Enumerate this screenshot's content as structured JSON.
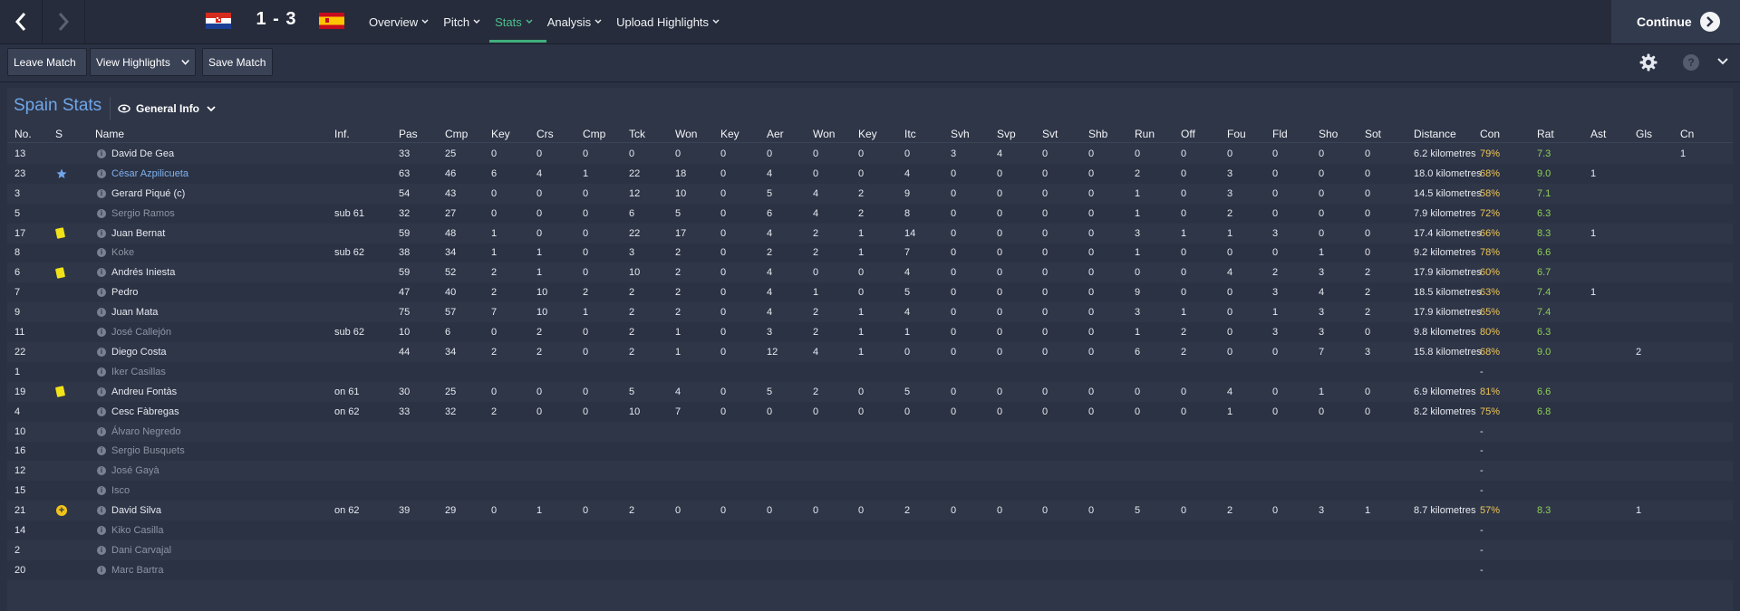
{
  "header": {
    "score": "1 - 3",
    "home_flag": "croatia-flag",
    "away_flag": "spain-flag",
    "menu": [
      {
        "label": "Overview",
        "active": false
      },
      {
        "label": "Pitch",
        "active": false
      },
      {
        "label": "Stats",
        "active": true
      },
      {
        "label": "Analysis",
        "active": false
      },
      {
        "label": "Upload Highlights",
        "active": false
      }
    ],
    "continue_label": "Continue"
  },
  "toolbar": {
    "leave_label": "Leave Match",
    "highlights_label": "View Highlights",
    "save_label": "Save Match"
  },
  "panel": {
    "title": "Spain Stats",
    "view_label": "General Info"
  },
  "colors": {
    "accent_green": "#3fae7c",
    "title_blue": "#6fa6e8",
    "condition_yellow": "#f0c654",
    "rating_green": "#8fcf5a",
    "yellow_card": "#f2e318"
  },
  "table": {
    "columns": [
      "No.",
      "S",
      "Name",
      "Inf.",
      "Pas",
      "Cmp",
      "Key",
      "Crs",
      "Cmp",
      "Tck",
      "Won",
      "Key",
      "Aer",
      "Won",
      "Key",
      "Itc",
      "Svh",
      "Svp",
      "Svt",
      "Shb",
      "Run",
      "Off",
      "Fou",
      "Fld",
      "Sho",
      "Sot",
      "Distance",
      "Con",
      "Rat",
      "Ast",
      "Gls",
      "Cn"
    ],
    "rows": [
      {
        "no": "13",
        "s": "",
        "name": "David De Gea",
        "style": "normal",
        "inf": "",
        "stats": [
          "33",
          "25",
          "0",
          "0",
          "0",
          "0",
          "0",
          "0",
          "0",
          "0",
          "0",
          "0",
          "3",
          "4",
          "0",
          "0",
          "0",
          "0",
          "0",
          "0",
          "0",
          "0"
        ],
        "dist": "6.2 kilometres",
        "con": "79%",
        "rat": "7.3",
        "ast": "",
        "gls": "",
        "cn": "1"
      },
      {
        "no": "23",
        "s": "star",
        "name": "César Azpilicueta",
        "style": "link",
        "inf": "",
        "stats": [
          "63",
          "46",
          "6",
          "4",
          "1",
          "22",
          "18",
          "0",
          "4",
          "0",
          "0",
          "4",
          "0",
          "0",
          "0",
          "0",
          "2",
          "0",
          "3",
          "0",
          "0",
          "0"
        ],
        "dist": "18.0 kilometres",
        "con": "68%",
        "rat": "9.0",
        "ast": "1",
        "gls": "",
        "cn": ""
      },
      {
        "no": "3",
        "s": "",
        "name": "Gerard Piqué (c)",
        "style": "normal",
        "inf": "",
        "stats": [
          "54",
          "43",
          "0",
          "0",
          "0",
          "12",
          "10",
          "0",
          "5",
          "4",
          "2",
          "9",
          "0",
          "0",
          "0",
          "0",
          "1",
          "0",
          "3",
          "0",
          "0",
          "0"
        ],
        "dist": "14.5 kilometres",
        "con": "58%",
        "rat": "7.1",
        "ast": "",
        "gls": "",
        "cn": ""
      },
      {
        "no": "5",
        "s": "",
        "name": "Sergio Ramos",
        "style": "dim",
        "inf": "sub 61",
        "stats": [
          "32",
          "27",
          "0",
          "0",
          "0",
          "6",
          "5",
          "0",
          "6",
          "4",
          "2",
          "8",
          "0",
          "0",
          "0",
          "0",
          "1",
          "0",
          "2",
          "0",
          "0",
          "0"
        ],
        "dist": "7.9 kilometres",
        "con": "72%",
        "rat": "6.3",
        "ast": "",
        "gls": "",
        "cn": ""
      },
      {
        "no": "17",
        "s": "yellow",
        "name": "Juan Bernat",
        "style": "normal",
        "inf": "",
        "stats": [
          "59",
          "48",
          "1",
          "0",
          "0",
          "22",
          "17",
          "0",
          "4",
          "2",
          "1",
          "14",
          "0",
          "0",
          "0",
          "0",
          "3",
          "1",
          "1",
          "3",
          "0",
          "0"
        ],
        "dist": "17.4 kilometres",
        "con": "66%",
        "rat": "8.3",
        "ast": "1",
        "gls": "",
        "cn": ""
      },
      {
        "no": "8",
        "s": "",
        "name": "Koke",
        "style": "dim",
        "inf": "sub 62",
        "stats": [
          "38",
          "34",
          "1",
          "1",
          "0",
          "3",
          "2",
          "0",
          "2",
          "2",
          "1",
          "7",
          "0",
          "0",
          "0",
          "0",
          "1",
          "0",
          "0",
          "0",
          "1",
          "0"
        ],
        "dist": "9.2 kilometres",
        "con": "78%",
        "rat": "6.6",
        "ast": "",
        "gls": "",
        "cn": ""
      },
      {
        "no": "6",
        "s": "yellow",
        "name": "Andrés Iniesta",
        "style": "normal",
        "inf": "",
        "stats": [
          "59",
          "52",
          "2",
          "1",
          "0",
          "10",
          "2",
          "0",
          "4",
          "0",
          "0",
          "4",
          "0",
          "0",
          "0",
          "0",
          "0",
          "0",
          "4",
          "2",
          "3",
          "2"
        ],
        "dist": "17.9 kilometres",
        "con": "60%",
        "rat": "6.7",
        "ast": "",
        "gls": "",
        "cn": ""
      },
      {
        "no": "7",
        "s": "",
        "name": "Pedro",
        "style": "normal",
        "inf": "",
        "stats": [
          "47",
          "40",
          "2",
          "10",
          "2",
          "2",
          "2",
          "0",
          "4",
          "1",
          "0",
          "5",
          "0",
          "0",
          "0",
          "0",
          "9",
          "0",
          "0",
          "3",
          "4",
          "2"
        ],
        "dist": "18.5 kilometres",
        "con": "63%",
        "rat": "7.4",
        "ast": "1",
        "gls": "",
        "cn": ""
      },
      {
        "no": "9",
        "s": "",
        "name": "Juan Mata",
        "style": "normal",
        "inf": "",
        "stats": [
          "75",
          "57",
          "7",
          "10",
          "1",
          "2",
          "2",
          "0",
          "4",
          "2",
          "1",
          "4",
          "0",
          "0",
          "0",
          "0",
          "3",
          "1",
          "0",
          "1",
          "3",
          "2"
        ],
        "dist": "17.9 kilometres",
        "con": "65%",
        "rat": "7.4",
        "ast": "",
        "gls": "",
        "cn": ""
      },
      {
        "no": "11",
        "s": "",
        "name": "José Callejón",
        "style": "dim",
        "inf": "sub 62",
        "stats": [
          "10",
          "6",
          "0",
          "2",
          "0",
          "2",
          "1",
          "0",
          "3",
          "2",
          "1",
          "1",
          "0",
          "0",
          "0",
          "0",
          "1",
          "2",
          "0",
          "3",
          "3",
          "0"
        ],
        "dist": "9.8 kilometres",
        "con": "80%",
        "rat": "6.3",
        "ast": "",
        "gls": "",
        "cn": ""
      },
      {
        "no": "22",
        "s": "",
        "name": "Diego Costa",
        "style": "normal",
        "inf": "",
        "stats": [
          "44",
          "34",
          "2",
          "2",
          "0",
          "2",
          "1",
          "0",
          "12",
          "4",
          "1",
          "0",
          "0",
          "0",
          "0",
          "0",
          "6",
          "2",
          "0",
          "0",
          "7",
          "3"
        ],
        "dist": "15.8 kilometres",
        "con": "68%",
        "rat": "9.0",
        "ast": "",
        "gls": "2",
        "cn": ""
      },
      {
        "no": "1",
        "s": "",
        "name": "Iker Casillas",
        "style": "dim",
        "inf": "",
        "stats": [],
        "dist": "",
        "con": "-",
        "rat": "",
        "ast": "",
        "gls": "",
        "cn": ""
      },
      {
        "no": "19",
        "s": "yellow",
        "name": "Andreu Fontàs",
        "style": "normal",
        "inf": "on 61",
        "stats": [
          "30",
          "25",
          "0",
          "0",
          "0",
          "5",
          "4",
          "0",
          "5",
          "2",
          "0",
          "5",
          "0",
          "0",
          "0",
          "0",
          "0",
          "0",
          "4",
          "0",
          "1",
          "0"
        ],
        "dist": "6.9 kilometres",
        "con": "81%",
        "rat": "6.6",
        "ast": "",
        "gls": "",
        "cn": ""
      },
      {
        "no": "4",
        "s": "",
        "name": "Cesc Fàbregas",
        "style": "normal",
        "inf": "on 62",
        "stats": [
          "33",
          "32",
          "2",
          "0",
          "0",
          "10",
          "7",
          "0",
          "0",
          "0",
          "0",
          "0",
          "0",
          "0",
          "0",
          "0",
          "0",
          "0",
          "1",
          "0",
          "0",
          "0"
        ],
        "dist": "8.2 kilometres",
        "con": "75%",
        "rat": "6.8",
        "ast": "",
        "gls": "",
        "cn": ""
      },
      {
        "no": "10",
        "s": "",
        "name": "Álvaro Negredo",
        "style": "dim",
        "inf": "",
        "stats": [],
        "dist": "",
        "con": "-",
        "rat": "",
        "ast": "",
        "gls": "",
        "cn": ""
      },
      {
        "no": "16",
        "s": "",
        "name": "Sergio Busquets",
        "style": "dim",
        "inf": "",
        "stats": [],
        "dist": "",
        "con": "-",
        "rat": "",
        "ast": "",
        "gls": "",
        "cn": ""
      },
      {
        "no": "12",
        "s": "",
        "name": "José Gayà",
        "style": "dim",
        "inf": "",
        "stats": [],
        "dist": "",
        "con": "-",
        "rat": "",
        "ast": "",
        "gls": "",
        "cn": ""
      },
      {
        "no": "15",
        "s": "",
        "name": "Isco",
        "style": "dim",
        "inf": "",
        "stats": [],
        "dist": "",
        "con": "-",
        "rat": "",
        "ast": "",
        "gls": "",
        "cn": ""
      },
      {
        "no": "21",
        "s": "sub",
        "name": "David Silva",
        "style": "normal",
        "inf": "on 62",
        "stats": [
          "39",
          "29",
          "0",
          "1",
          "0",
          "2",
          "0",
          "0",
          "0",
          "0",
          "0",
          "2",
          "0",
          "0",
          "0",
          "0",
          "5",
          "0",
          "2",
          "0",
          "3",
          "1"
        ],
        "dist": "8.7 kilometres",
        "con": "57%",
        "rat": "8.3",
        "ast": "",
        "gls": "1",
        "cn": ""
      },
      {
        "no": "14",
        "s": "",
        "name": "Kiko Casilla",
        "style": "dim",
        "inf": "",
        "stats": [],
        "dist": "",
        "con": "-",
        "rat": "",
        "ast": "",
        "gls": "",
        "cn": ""
      },
      {
        "no": "2",
        "s": "",
        "name": "Dani Carvajal",
        "style": "dim",
        "inf": "",
        "stats": [],
        "dist": "",
        "con": "-",
        "rat": "",
        "ast": "",
        "gls": "",
        "cn": ""
      },
      {
        "no": "20",
        "s": "",
        "name": "Marc Bartra",
        "style": "dim",
        "inf": "",
        "stats": [],
        "dist": "",
        "con": "-",
        "rat": "",
        "ast": "",
        "gls": "",
        "cn": ""
      }
    ]
  }
}
